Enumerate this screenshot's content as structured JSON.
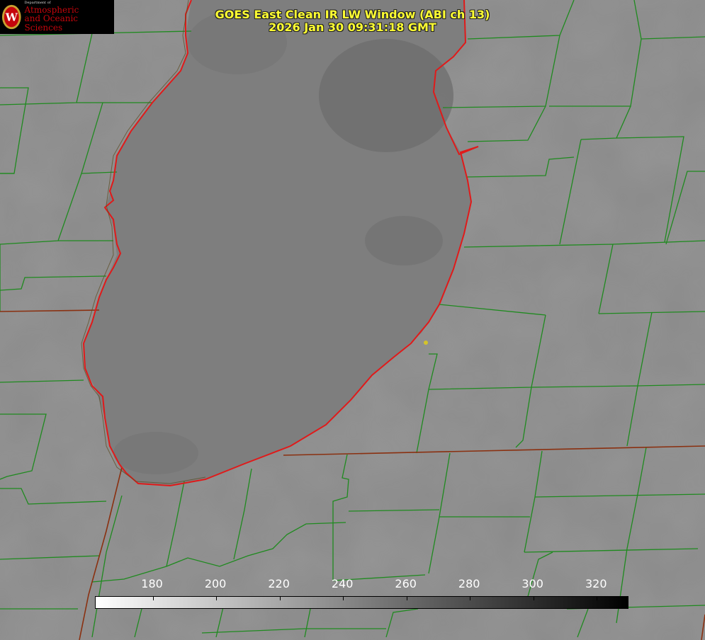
{
  "title": {
    "line1": "GOES East Clean IR LW Window (ABI ch 13)",
    "line2": "2026 Jan 30 09:31:18 GMT"
  },
  "logo": {
    "dept": "Department of",
    "line1": "Atmospheric",
    "line2": "and Oceanic Sciences",
    "seal_letter": "W"
  },
  "colorbar": {
    "min": 162,
    "max": 330,
    "ticks": [
      "180",
      "200",
      "220",
      "240",
      "260",
      "280",
      "300",
      "320"
    ],
    "colors": [
      "#ffffff",
      "#000000"
    ]
  },
  "colors": {
    "county_lines": "#1f8a1f",
    "coastline": "#e01a1a",
    "state_lines": "#8a3010",
    "marker": "#d4c42a",
    "land": "#8a8a8a",
    "lake": "#7e7e7e"
  }
}
